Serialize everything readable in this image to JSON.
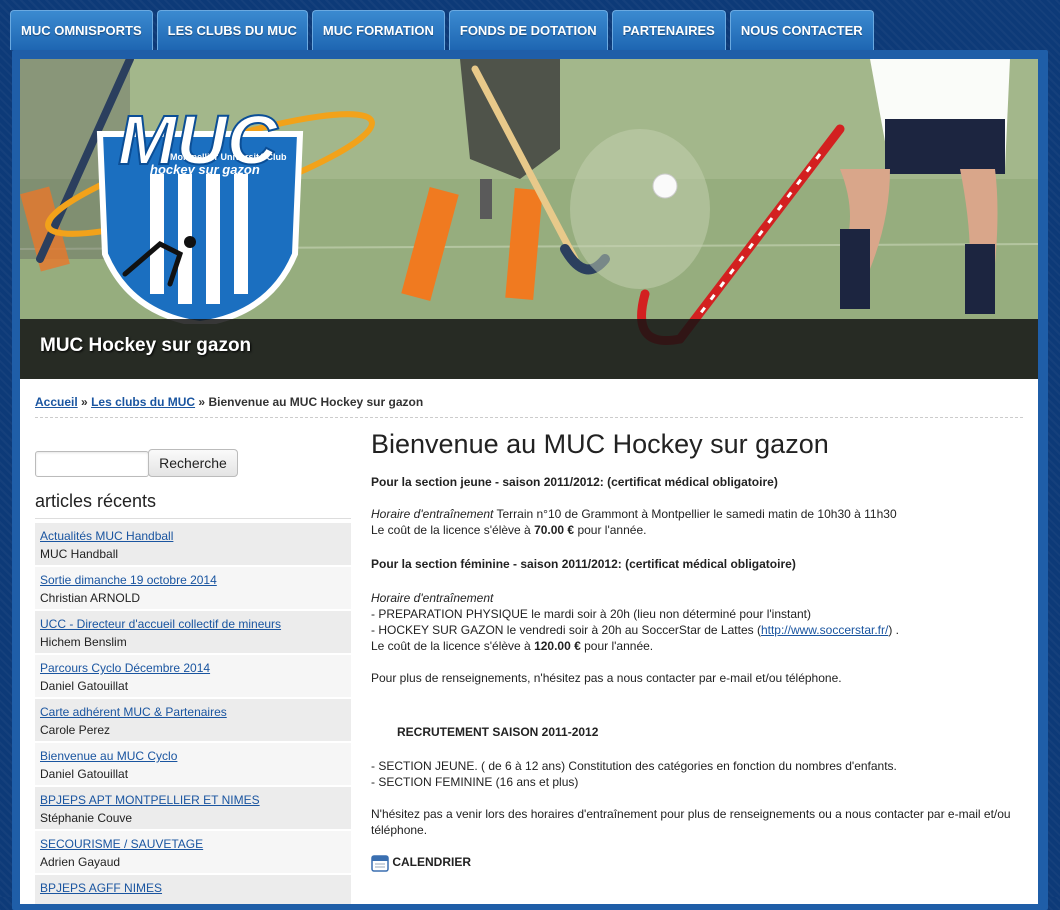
{
  "nav": {
    "tabs": [
      "MUC OMNISPORTS",
      "LES CLUBS DU MUC",
      "MUC FORMATION",
      "FONDS DE DOTATION",
      "PARTENAIRES",
      "NOUS CONTACTER"
    ]
  },
  "banner": {
    "title": "MUC Hockey sur gazon",
    "logo_text": "MUC",
    "logo_subtitle": "Montpellier Université Club",
    "logo_tagline": "hockey sur gazon"
  },
  "breadcrumb": {
    "home": "Accueil",
    "sep": "»",
    "clubs": "Les clubs du MUC",
    "current": "Bienvenue au MUC Hockey sur gazon"
  },
  "search": {
    "placeholder": "",
    "button": "Recherche"
  },
  "sidebar": {
    "heading": "articles récents",
    "articles": [
      {
        "title": "Actualités MUC Handball",
        "author": "MUC Handball"
      },
      {
        "title": "Sortie dimanche 19 octobre 2014",
        "author": "Christian ARNOLD"
      },
      {
        "title": "UCC - Directeur d'accueil collectif de mineurs",
        "author": "Hichem Benslim"
      },
      {
        "title": "Parcours Cyclo Décembre 2014",
        "author": "Daniel Gatouillat"
      },
      {
        "title": "Carte adhérent MUC & Partenaires",
        "author": "Carole Perez"
      },
      {
        "title": "Bienvenue au MUC Cyclo",
        "author": "Daniel Gatouillat"
      },
      {
        "title": "BPJEPS APT MONTPELLIER ET NIMES",
        "author": "Stéphanie Couve"
      },
      {
        "title": "SECOURISME / SAUVETAGE",
        "author": "Adrien Gayaud"
      },
      {
        "title": "BPJEPS AGFF NIMES",
        "author": ""
      }
    ]
  },
  "main": {
    "title": "Bienvenue au MUC Hockey sur gazon",
    "jeune_heading": "Pour la section jeune - saison 2011/2012: (certificat médical obligatoire)",
    "horaire_label": "Horaire d'entraînement",
    "jeune_horaire": " Terrain n°10 de Grammont à Montpellier le samedi matin de 10h30 à 11h30",
    "licence_prefix": "Le coût de la licence s'élève à ",
    "jeune_price": "70.00 €",
    "licence_suffix": " pour l'année.",
    "feminine_heading": "Pour la section féminine - saison 2011/2012:  (certificat médical obligatoire)",
    "feminine_line1": "- PREPARATION PHYSIQUE le mardi soir à 20h (lieu non déterminé pour l'instant)",
    "feminine_line2": "- HOCKEY SUR GAZON le vendredi soir à 20h au SoccerStar de Lattes (",
    "feminine_link": "http://www.soccerstar.fr/",
    "feminine_line2_end": ") .",
    "feminine_price": "120.00 €",
    "contact_text": "Pour plus de renseignements, n'hésitez pas a nous contacter par e-mail et/ou téléphone.",
    "recrutement_heading": "RECRUTEMENT SAISON 2011-2012",
    "recrutement_line1": "- SECTION JEUNE. ( de 6 à 12 ans) Constitution des catégories en fonction du nombres d'enfants.",
    "recrutement_line2": "- SECTION FEMININE (16 ans et plus)",
    "closing_text": "N'hésitez pas a venir lors des horaires d'entraînement pour plus de renseignements ou a nous contacter par e-mail et/ou téléphone.",
    "calendar_label": "CALENDRIER"
  },
  "colors": {
    "background": "#0d3a78",
    "nav_tab": "#2a78c4",
    "link": "#1a55a0"
  }
}
